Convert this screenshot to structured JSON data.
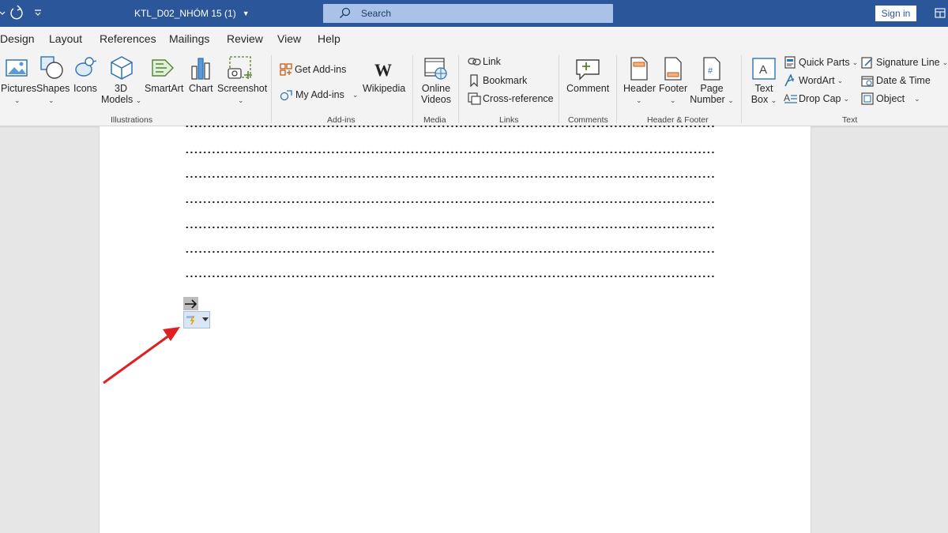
{
  "titlebar": {
    "doc_title": "KTL_D02_NHÓM 15 (1)",
    "search_placeholder": "Search",
    "signin_label": "Sign in"
  },
  "menu": {
    "tabs": [
      "Design",
      "Layout",
      "References",
      "Mailings",
      "Review",
      "View",
      "Help"
    ]
  },
  "ribbon": {
    "illustrations": {
      "pictures": "Pictures",
      "shapes": "Shapes",
      "icons": "Icons",
      "models_line1": "3D",
      "models_line2": "Models",
      "smartart": "SmartArt",
      "chart": "Chart",
      "screenshot": "Screenshot",
      "group_label": "Illustrations"
    },
    "addins": {
      "get_addins": "Get Add-ins",
      "my_addins": "My Add-ins",
      "wikipedia": "Wikipedia",
      "group_label": "Add-ins"
    },
    "media": {
      "online_line1": "Online",
      "online_line2": "Videos",
      "group_label": "Media"
    },
    "links": {
      "link": "Link",
      "bookmark": "Bookmark",
      "cross_reference": "Cross-reference",
      "group_label": "Links"
    },
    "comments": {
      "comment": "Comment",
      "group_label": "Comments"
    },
    "header_footer": {
      "header": "Header",
      "footer": "Footer",
      "page_line1": "Page",
      "page_line2": "Number",
      "group_label": "Header & Footer"
    },
    "text": {
      "textbox_line1": "Text",
      "textbox_line2": "Box",
      "quick_parts": "Quick Parts",
      "wordart": "WordArt",
      "drop_cap": "Drop Cap",
      "signature_line": "Signature Line",
      "date_time": "Date & Time",
      "object": "Object",
      "group_label": "Text"
    }
  },
  "colors": {
    "title_bar": "#2b579a",
    "ribbon_bg": "#f3f3f3",
    "annotation_arrow": "#e02020"
  }
}
